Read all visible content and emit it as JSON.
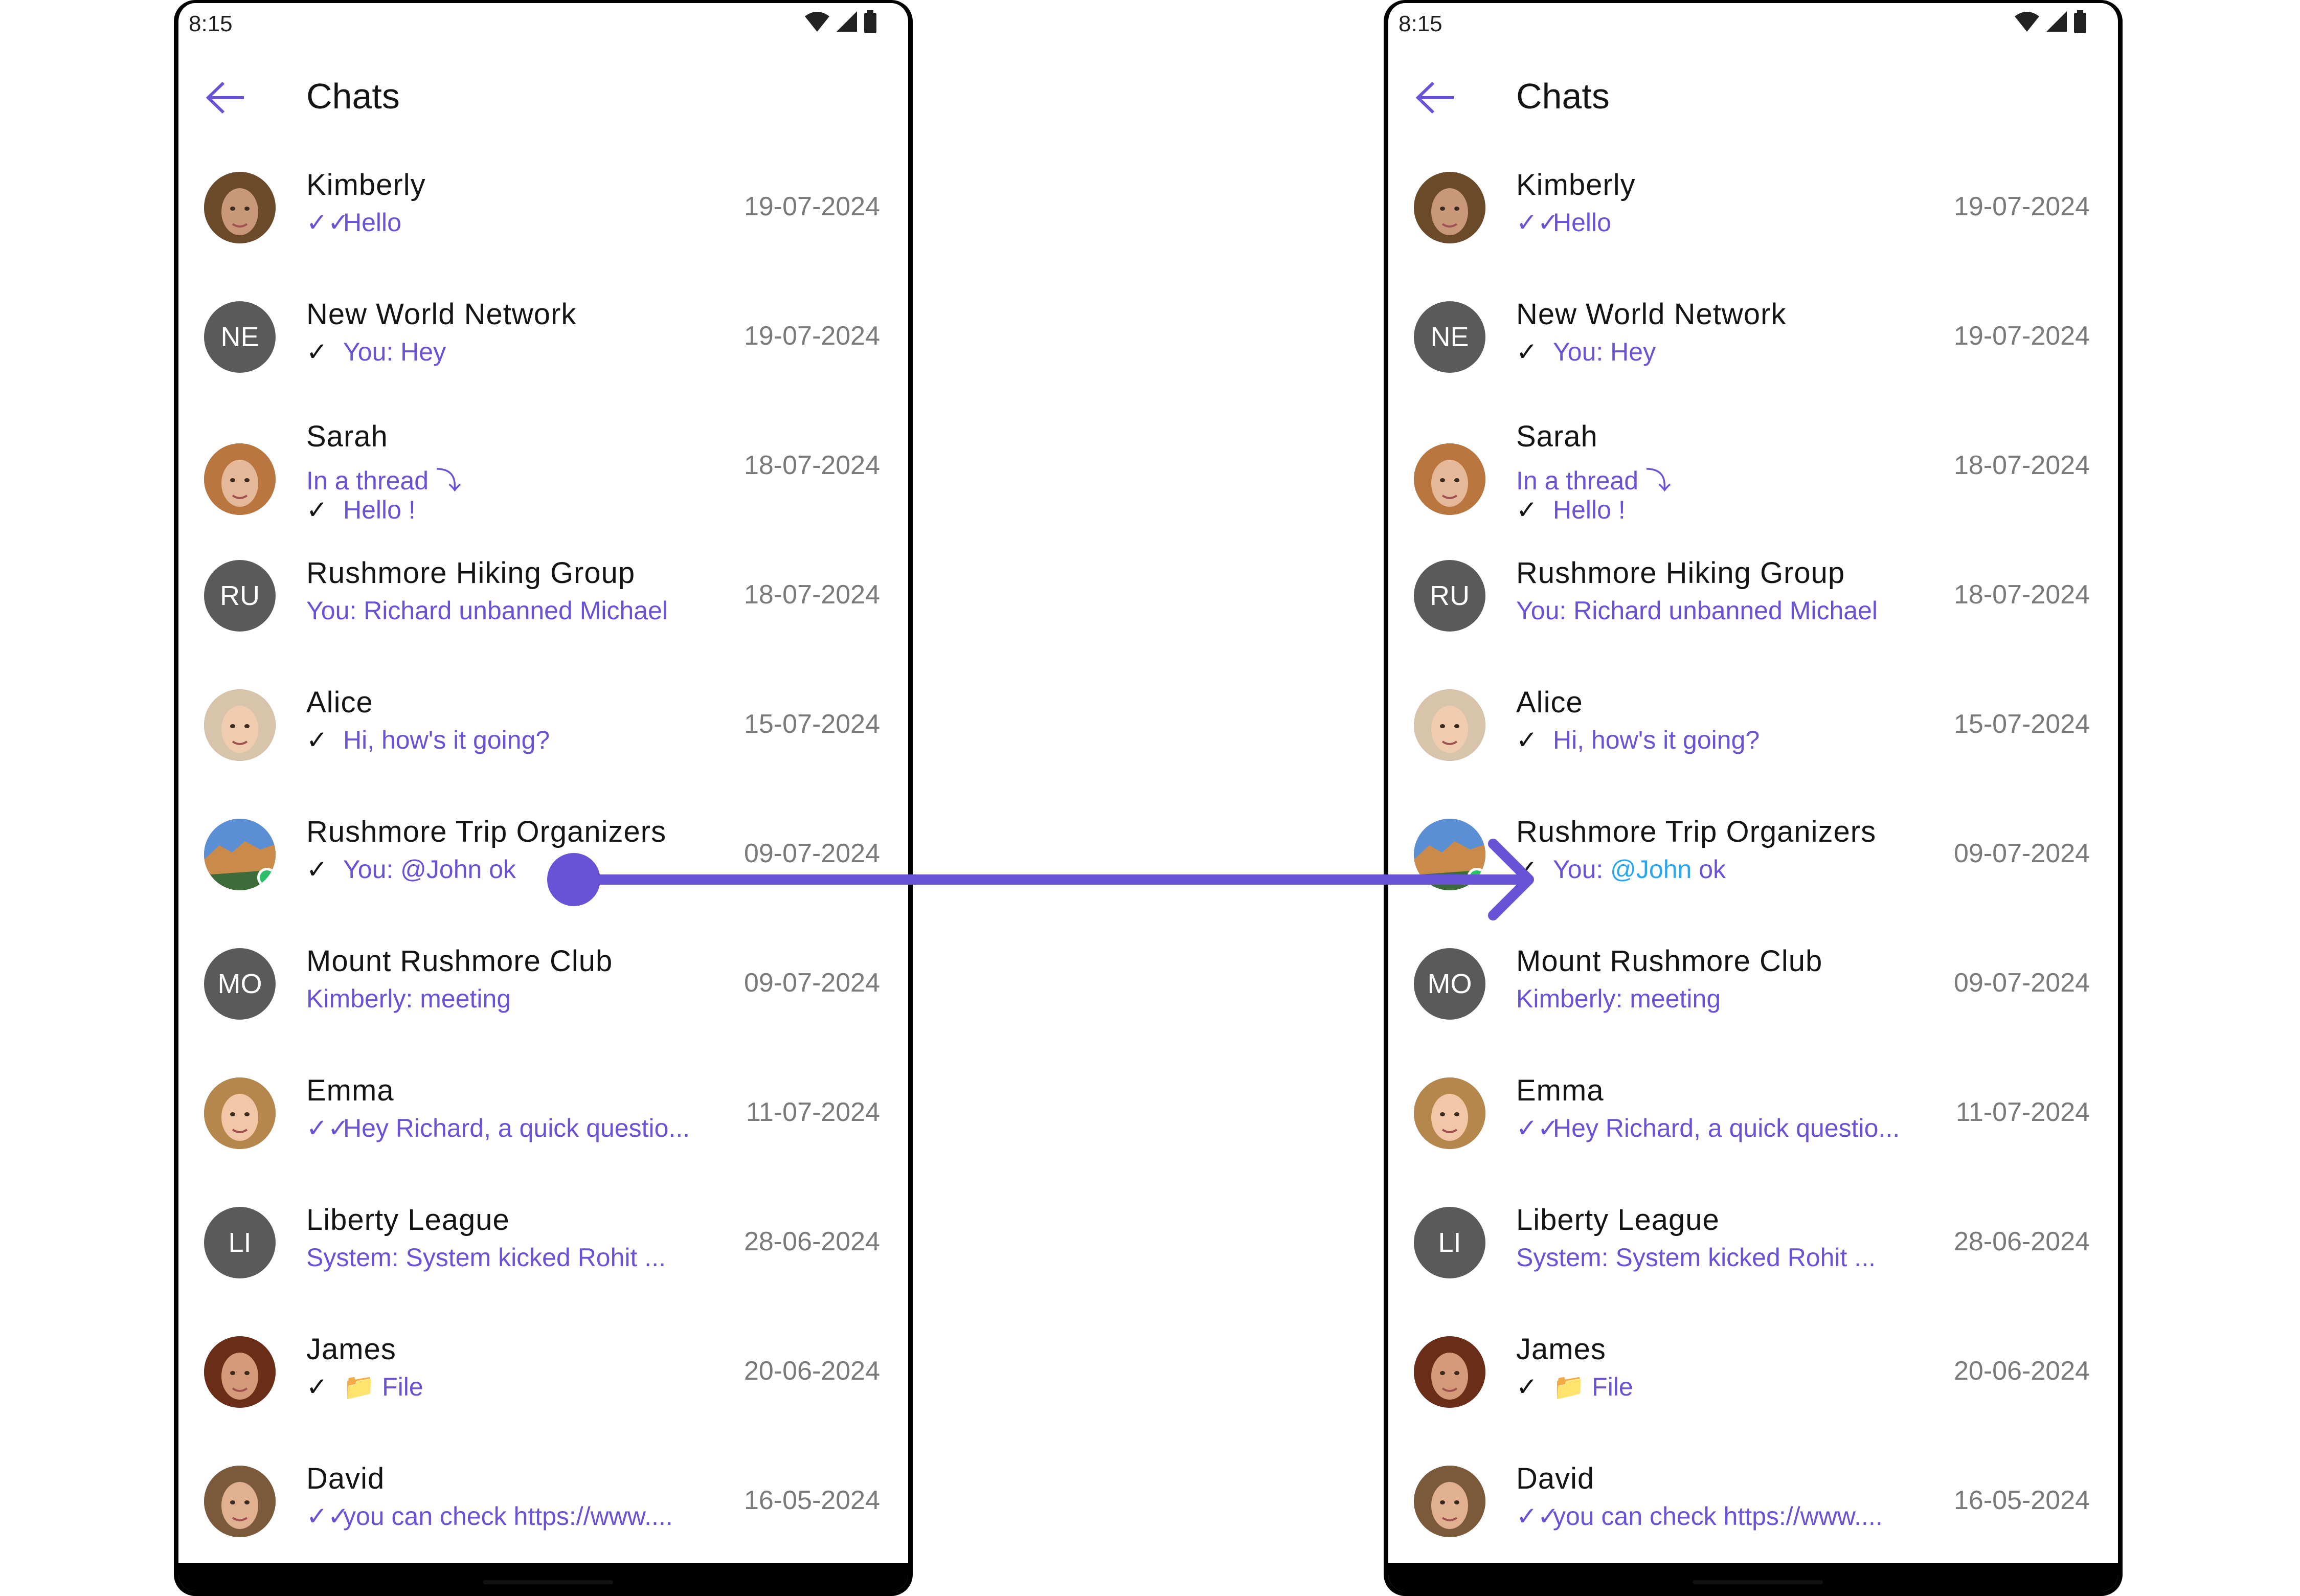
{
  "status_time": "8:15",
  "title": "Chats",
  "chats": [
    {
      "name": "Kimberly",
      "line1": "Hello",
      "tick1": "✓✓",
      "date": "19-07-2024",
      "avatar": "photo",
      "skin": "#c89878",
      "hair": "#6b4a2a"
    },
    {
      "name": "New World Network",
      "line1": "You: Hey",
      "tick1": "✓",
      "date": "19-07-2024",
      "avatar": "NE"
    },
    {
      "name": "Sarah",
      "line1": "In a thread ⤵",
      "line2": "Hello !",
      "tick2": "✓",
      "date": "18-07-2024",
      "avatar": "photo",
      "skin": "#e6b89a",
      "hair": "#b9773f"
    },
    {
      "name": "Rushmore Hiking Group",
      "line1": "You: Richard unbanned Michael",
      "date": "18-07-2024",
      "avatar": "RU",
      "badge": "#f5a623"
    },
    {
      "name": "Alice",
      "line1": "Hi, how's it going?",
      "tick1": "✓",
      "date": "15-07-2024",
      "avatar": "photo",
      "skin": "#f0cdb0",
      "hair": "#d8c4aa"
    },
    {
      "name": "Rushmore Trip Organizers",
      "line1_prefix": "You: ",
      "line1_mention": "@John",
      "line1_suffix": " ok",
      "tick1": "✓",
      "date": "09-07-2024",
      "avatar": "landscape",
      "badge": "#2bbf6a"
    },
    {
      "name": "Mount Rushmore Club",
      "line1": "Kimberly: meeting",
      "date": "09-07-2024",
      "avatar": "MO"
    },
    {
      "name": "Emma",
      "line1": "Hey Richard, a quick questio...",
      "tick1": "✓✓",
      "date": "11-07-2024",
      "avatar": "photo",
      "skin": "#f2c6a6",
      "hair": "#b5874d"
    },
    {
      "name": "Liberty League",
      "line1": "System: System kicked Rohit ...",
      "date": "28-06-2024",
      "avatar": "LI"
    },
    {
      "name": "James",
      "line1": "📁 File",
      "tick1": "✓",
      "date": "20-06-2024",
      "avatar": "photo",
      "skin": "#d59a7a",
      "hair": "#6a2d18"
    },
    {
      "name": "David",
      "line1": "you can check https://www....",
      "tick1": "✓✓",
      "date": "16-05-2024",
      "avatar": "photo",
      "skin": "#e0b090",
      "hair": "#7a5a3a"
    }
  ],
  "colors": {
    "accent": "#6852d6",
    "mention": "#2aa6f0",
    "avatar_bg": "#5a5a5a"
  }
}
